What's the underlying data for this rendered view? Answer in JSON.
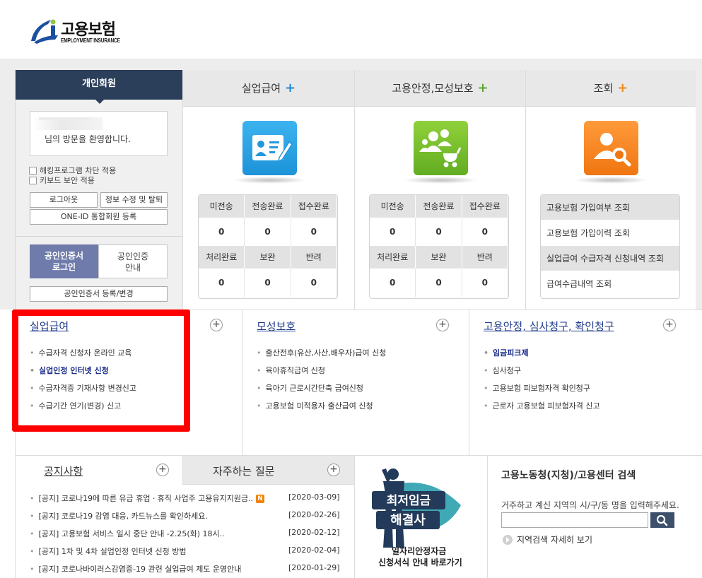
{
  "header": {
    "logo_text": "고용보험",
    "logo_sub": "EMPLOYMENT INSURANCE"
  },
  "member": {
    "title": "개인회원",
    "welcome": "님의 방문을 환영합니다.",
    "check_hacking": "해킹프로그램 차단 적용",
    "check_keyboard": "키보드 보안 적용",
    "logout": "로그아웃",
    "edit_info": "정보 수정 및 탈퇴",
    "oneid": "ONE-ID 통합회원 등록",
    "cert_login_1": "공인인증서",
    "cert_login_2": "로그인",
    "cert_guide_1": "공인인증",
    "cert_guide_2": "안내",
    "cert_register": "공인인증서 등록/변경"
  },
  "services": [
    {
      "title": "실업급여",
      "plus": "+",
      "plus_color": "#1e88d8",
      "icon": "id-card-pen-icon",
      "icon_color": "#2aa3e6",
      "labels_top": [
        "미전송",
        "전송완료",
        "접수완료"
      ],
      "values_top": [
        "0",
        "0",
        "0"
      ],
      "labels_bottom": [
        "처리완료",
        "보완",
        "반려"
      ],
      "values_bottom": [
        "0",
        "0",
        "0"
      ]
    },
    {
      "title": "고용안정,모성보호",
      "plus": "+",
      "plus_color": "#5aa82a",
      "icon": "family-stroller-icon",
      "icon_color": "#7cc22e",
      "labels_top": [
        "미전송",
        "전송완료",
        "접수완료"
      ],
      "values_top": [
        "0",
        "0",
        "0"
      ],
      "labels_bottom": [
        "처리완료",
        "보완",
        "반려"
      ],
      "values_bottom": [
        "0",
        "0",
        "0"
      ]
    },
    {
      "title": "조회",
      "plus": "+",
      "plus_color": "#f08a1c",
      "icon": "user-search-icon",
      "icon_color": "#f5821f",
      "items": [
        "고용보험 가입여부 조회",
        "고용보험 가입이력 조회",
        "실업급여 수급자격 신청내역 조회",
        "급여수급내역 조회"
      ]
    }
  ],
  "links": [
    {
      "title": "실업급여",
      "items": [
        "수급자격 신청자 온라인 교육",
        "실업인정 인터넷 신청",
        "수급자격증 기재사항 변경신고",
        "수급기간 연기(변경) 신고"
      ],
      "highlight": 1
    },
    {
      "title": "모성보호",
      "items": [
        "출산전후(유산,사산,배우자)급여 신청",
        "육아휴직급여 신청",
        "육아기 근로시간단축 급여신청",
        "고용보험 미적용자 출산급여 신청"
      ],
      "highlight": -1
    },
    {
      "title": "고용안정, 심사청구, 확인청구",
      "items": [
        "임금피크제",
        "심사청구",
        "고용보험 피보험자격 확인청구",
        "근로자 고용보험 피보험자격 신고"
      ],
      "highlight": 0
    }
  ],
  "notice": {
    "tab1": "공지사항",
    "tab2": "자주하는 질문",
    "new_badge": "N",
    "items": [
      {
        "text": "[공지] 코로나19에 따른 유급 휴업ㆍ휴직 사업주 고용유지지원금..",
        "date": "[2020-03-09]",
        "new": true
      },
      {
        "text": "[공지] 코로나19 감염 대응, 카드뉴스를 확인하세요.",
        "date": "[2020-02-26]",
        "new": false
      },
      {
        "text": "[공지] 고용보험 서비스 일시 중단 안내 -2.25(화) 18시..",
        "date": "[2020-02-12]",
        "new": false
      },
      {
        "text": "[공지] 1차 및 4차 실업인정 인터넷 신청 방법",
        "date": "[2020-02-04]",
        "new": false
      },
      {
        "text": "[공지] 코로나바이러스감염증-19 관련 실업급여 제도 운영안내",
        "date": "[2020-01-29]",
        "new": false
      }
    ]
  },
  "banner": {
    "headline_1": "최저임금",
    "headline_2": "해결사",
    "line1": "일자리안정자금",
    "line2": "신청서식 안내 바로가기"
  },
  "office": {
    "title": "고용노동청(지청)/고용센터 검색",
    "desc": "거주하고 계신 지역의 시/구/동 명을 입력해주세요.",
    "input_value": "",
    "more": "지역검색 자세히 보기"
  }
}
